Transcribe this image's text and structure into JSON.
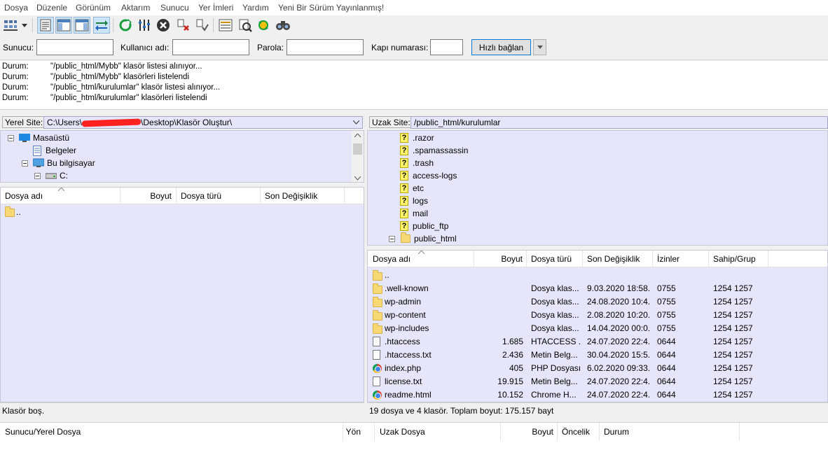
{
  "menu": [
    "Dosya",
    "Düzenle",
    "Görünüm",
    "Aktarım",
    "Sunucu",
    "Yer İmleri",
    "Yardım",
    "Yeni Bir Sürüm Yayınlanmış!"
  ],
  "toolbar": {
    "icons": [
      "site-manager-icon",
      "dropdown-arrow-icon",
      "toggle-log-icon",
      "toggle-local-tree-icon",
      "toggle-remote-tree-icon",
      "toggle-queue-icon",
      "refresh-icon",
      "process-queue-icon",
      "cancel-icon",
      "disconnect-icon",
      "reconnect-icon",
      "filter-icon",
      "compare-icon",
      "sync-browse-icon",
      "search-icon"
    ]
  },
  "quickconnect": {
    "host_label": "Sunucu:",
    "user_label": "Kullanıcı adı:",
    "pass_label": "Parola:",
    "port_label": "Kapı numarası:",
    "host_value": "",
    "user_value": "",
    "pass_value": "",
    "port_value": "",
    "connect_label": "Hızlı bağlan"
  },
  "log": [
    {
      "label": "Durum:",
      "message": "\"/public_html/Mybb\" klasör listesi alınıyor..."
    },
    {
      "label": "Durum:",
      "message": "\"/public_html/Mybb\" klasörleri listelendi"
    },
    {
      "label": "Durum:",
      "message": "\"/public_html/kurulumlar\" klasör listesi alınıyor..."
    },
    {
      "label": "Durum:",
      "message": "\"/public_html/kurulumlar\" klasörleri listelendi"
    }
  ],
  "local": {
    "site_label": "Yerel Site:",
    "path_prefix": "C:\\Users\\",
    "path_suffix": "\\Desktop\\Klasör Oluştur\\",
    "tree": [
      "Masaüstü",
      "Belgeler",
      "Bu bilgisayar",
      "C:"
    ],
    "columns": [
      "Dosya adı",
      "Boyut",
      "Dosya türü",
      "Son Değişiklik"
    ],
    "files": [
      ".."
    ],
    "status": "Klasör boş."
  },
  "remote": {
    "site_label": "Uzak Site:",
    "path": "/public_html/kurulumlar",
    "tree": [
      ".razor",
      ".spamassassin",
      ".trash",
      "access-logs",
      "etc",
      "logs",
      "mail",
      "public_ftp",
      "public_html"
    ],
    "columns": [
      "Dosya adı",
      "Boyut",
      "Dosya türü",
      "Son Değişiklik",
      "İzinler",
      "Sahip/Grup"
    ],
    "files": [
      {
        "name": "..",
        "size": "",
        "type": "",
        "modified": "",
        "perms": "",
        "owner": "",
        "icon": "folder"
      },
      {
        "name": ".well-known",
        "size": "",
        "type": "Dosya klas...",
        "modified": "9.03.2020 18:58...",
        "perms": "0755",
        "owner": "1254 1257",
        "icon": "folder"
      },
      {
        "name": "wp-admin",
        "size": "",
        "type": "Dosya klas...",
        "modified": "24.08.2020 10:4...",
        "perms": "0755",
        "owner": "1254 1257",
        "icon": "folder"
      },
      {
        "name": "wp-content",
        "size": "",
        "type": "Dosya klas...",
        "modified": "2.08.2020 10:20...",
        "perms": "0755",
        "owner": "1254 1257",
        "icon": "folder"
      },
      {
        "name": "wp-includes",
        "size": "",
        "type": "Dosya klas...",
        "modified": "14.04.2020 00:0...",
        "perms": "0755",
        "owner": "1254 1257",
        "icon": "folder"
      },
      {
        "name": ".htaccess",
        "size": "1.685",
        "type": "HTACCESS ...",
        "modified": "24.07.2020 22:4...",
        "perms": "0644",
        "owner": "1254 1257",
        "icon": "doc"
      },
      {
        "name": ".htaccess.txt",
        "size": "2.436",
        "type": "Metin Belg...",
        "modified": "30.04.2020 15:5...",
        "perms": "0644",
        "owner": "1254 1257",
        "icon": "doc"
      },
      {
        "name": "index.php",
        "size": "405",
        "type": "PHP Dosyası",
        "modified": "6.02.2020 09:33...",
        "perms": "0644",
        "owner": "1254 1257",
        "icon": "chrome"
      },
      {
        "name": "license.txt",
        "size": "19.915",
        "type": "Metin Belg...",
        "modified": "24.07.2020 22:4...",
        "perms": "0644",
        "owner": "1254 1257",
        "icon": "doc"
      },
      {
        "name": "readme.html",
        "size": "10.152",
        "type": "Chrome H...",
        "modified": "24.07.2020 22:4...",
        "perms": "0644",
        "owner": "1254 1257",
        "icon": "chrome"
      }
    ],
    "status": "19 dosya ve 4 klasör. Toplam boyut: 175.157 bayt"
  },
  "queue": {
    "columns": [
      "Sunucu/Yerel Dosya",
      "Yön",
      "Uzak Dosya",
      "Boyut",
      "Öncelik",
      "Durum"
    ]
  },
  "colors": {
    "pane_bg": "#e6e6fa",
    "accent": "#0078d7",
    "redaction": "#ff0000"
  }
}
